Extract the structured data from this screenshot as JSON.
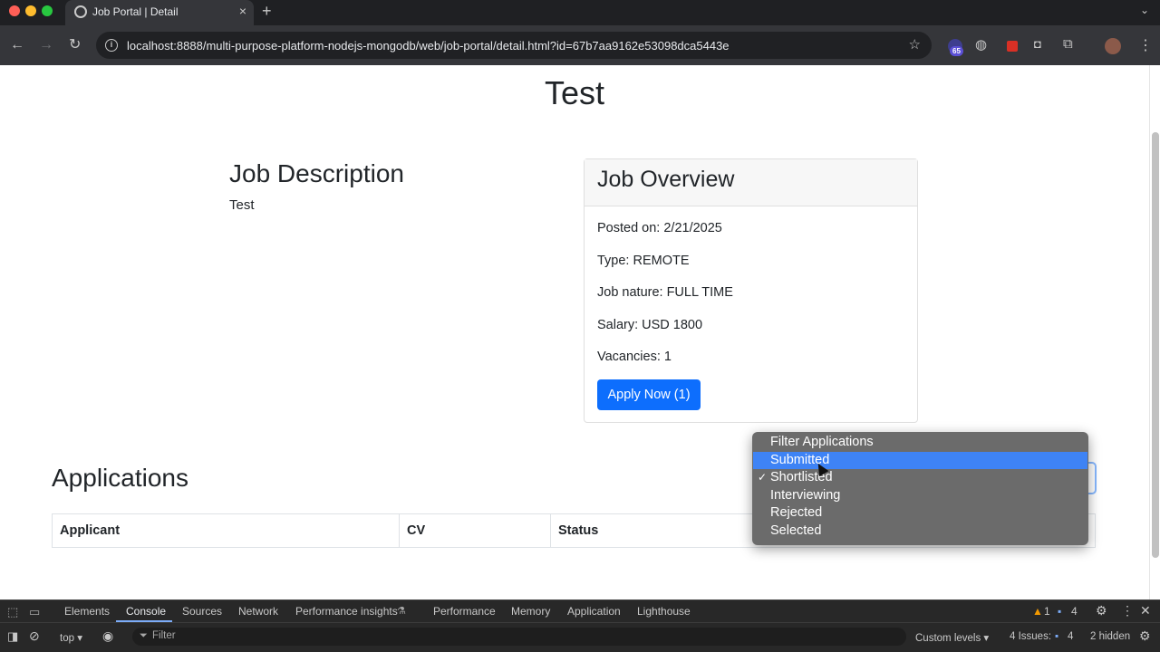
{
  "browser": {
    "tab_title": "Job Portal | Detail",
    "tab_close": "×",
    "new_tab": "+",
    "tab_menu": "⌄",
    "url": "localhost:8888/multi-purpose-platform-nodejs-mongodb/web/job-portal/detail.html?id=67b7aa9162e53098dca5443e",
    "extension_badge": "65",
    "nav_back": "←",
    "nav_forward": "→",
    "nav_reload": "↻",
    "bookmark_star": "☆",
    "info": "i",
    "menu": "⋮"
  },
  "page": {
    "title": "Test",
    "description_heading": "Job Description",
    "description_text": "Test",
    "overview": {
      "heading": "Job Overview",
      "posted_on": "Posted on: 2/21/2025",
      "type": "Type: REMOTE",
      "job_nature": "Job nature: FULL TIME",
      "salary": "Salary: USD 1800",
      "vacancies": "Vacancies: 1",
      "apply_label": "Apply Now (1)"
    },
    "applications_heading": "Applications",
    "table_headers": [
      "Applicant",
      "CV",
      "Status"
    ]
  },
  "dropdown": {
    "options": [
      "Filter Applications",
      "Submitted",
      "Shortlisted",
      "Interviewing",
      "Rejected",
      "Selected"
    ],
    "highlighted_option": "Submitted",
    "checked_option": "Shortlisted",
    "check_mark": "✓",
    "highlight_color": "#3e83f5"
  },
  "devtools": {
    "tabs": [
      "Elements",
      "Console",
      "Sources",
      "Network",
      "Performance insights",
      "Performance",
      "Memory",
      "Application",
      "Lighthouse"
    ],
    "active_tab": "Console",
    "warning_count": "1",
    "message_count": "4",
    "context": "top",
    "filter_placeholder": "Filter",
    "custom_levels": "Custom levels",
    "issues": "4 Issues:",
    "issues_count": "4",
    "hidden": "2 hidden"
  },
  "colors": {
    "primary_button": "#0d6efd",
    "devtools_bg": "#282828",
    "chrome_bg": "#35363a"
  }
}
